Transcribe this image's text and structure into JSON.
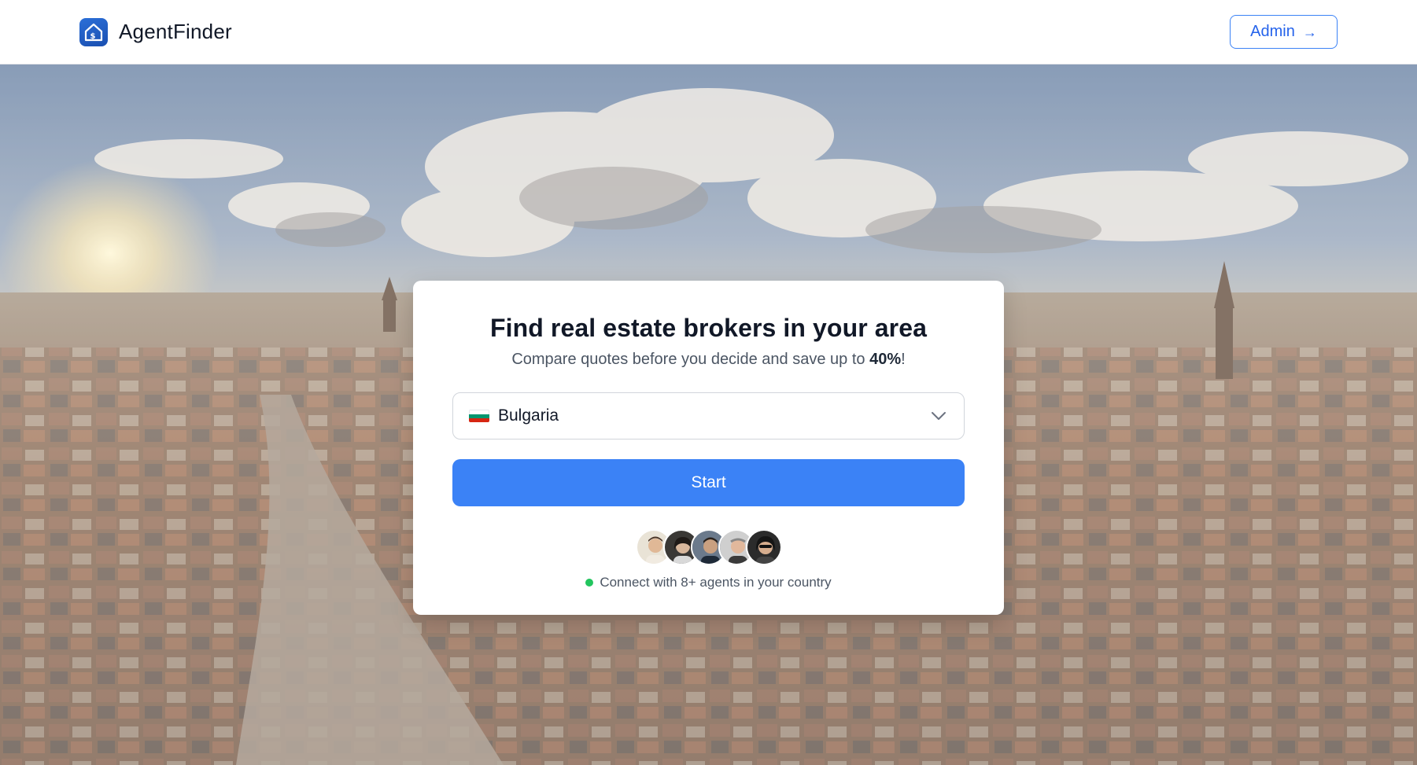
{
  "header": {
    "brand_name": "AgentFinder",
    "admin_label": "Admin",
    "admin_icon": "arrow-right-icon"
  },
  "card": {
    "title": "Find real estate brokers in your area",
    "subtitle_prefix": "Compare quotes before you decide and save up to ",
    "subtitle_highlight": "40%",
    "subtitle_suffix": "!",
    "country_select": {
      "selected": "Bulgaria",
      "flag_icon": "bulgaria-flag-icon"
    },
    "start_label": "Start",
    "agents_text": "Connect with 8+ agents in your country"
  },
  "colors": {
    "accent": "#3b82f6",
    "online": "#22c55e"
  }
}
